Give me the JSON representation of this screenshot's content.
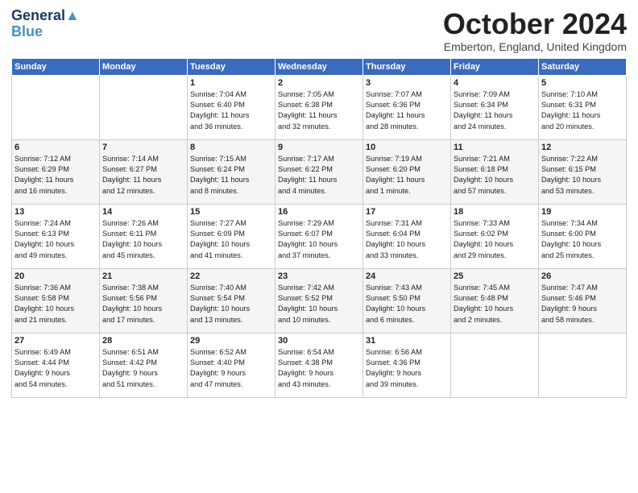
{
  "header": {
    "logo_line1": "General",
    "logo_line2": "Blue",
    "month": "October 2024",
    "location": "Emberton, England, United Kingdom"
  },
  "days_of_week": [
    "Sunday",
    "Monday",
    "Tuesday",
    "Wednesday",
    "Thursday",
    "Friday",
    "Saturday"
  ],
  "weeks": [
    [
      {
        "day": "",
        "content": ""
      },
      {
        "day": "",
        "content": ""
      },
      {
        "day": "1",
        "content": "Sunrise: 7:04 AM\nSunset: 6:40 PM\nDaylight: 11 hours\nand 36 minutes."
      },
      {
        "day": "2",
        "content": "Sunrise: 7:05 AM\nSunset: 6:38 PM\nDaylight: 11 hours\nand 32 minutes."
      },
      {
        "day": "3",
        "content": "Sunrise: 7:07 AM\nSunset: 6:36 PM\nDaylight: 11 hours\nand 28 minutes."
      },
      {
        "day": "4",
        "content": "Sunrise: 7:09 AM\nSunset: 6:34 PM\nDaylight: 11 hours\nand 24 minutes."
      },
      {
        "day": "5",
        "content": "Sunrise: 7:10 AM\nSunset: 6:31 PM\nDaylight: 11 hours\nand 20 minutes."
      }
    ],
    [
      {
        "day": "6",
        "content": "Sunrise: 7:12 AM\nSunset: 6:29 PM\nDaylight: 11 hours\nand 16 minutes."
      },
      {
        "day": "7",
        "content": "Sunrise: 7:14 AM\nSunset: 6:27 PM\nDaylight: 11 hours\nand 12 minutes."
      },
      {
        "day": "8",
        "content": "Sunrise: 7:15 AM\nSunset: 6:24 PM\nDaylight: 11 hours\nand 8 minutes."
      },
      {
        "day": "9",
        "content": "Sunrise: 7:17 AM\nSunset: 6:22 PM\nDaylight: 11 hours\nand 4 minutes."
      },
      {
        "day": "10",
        "content": "Sunrise: 7:19 AM\nSunset: 6:20 PM\nDaylight: 11 hours\nand 1 minute."
      },
      {
        "day": "11",
        "content": "Sunrise: 7:21 AM\nSunset: 6:18 PM\nDaylight: 10 hours\nand 57 minutes."
      },
      {
        "day": "12",
        "content": "Sunrise: 7:22 AM\nSunset: 6:15 PM\nDaylight: 10 hours\nand 53 minutes."
      }
    ],
    [
      {
        "day": "13",
        "content": "Sunrise: 7:24 AM\nSunset: 6:13 PM\nDaylight: 10 hours\nand 49 minutes."
      },
      {
        "day": "14",
        "content": "Sunrise: 7:26 AM\nSunset: 6:11 PM\nDaylight: 10 hours\nand 45 minutes."
      },
      {
        "day": "15",
        "content": "Sunrise: 7:27 AM\nSunset: 6:09 PM\nDaylight: 10 hours\nand 41 minutes."
      },
      {
        "day": "16",
        "content": "Sunrise: 7:29 AM\nSunset: 6:07 PM\nDaylight: 10 hours\nand 37 minutes."
      },
      {
        "day": "17",
        "content": "Sunrise: 7:31 AM\nSunset: 6:04 PM\nDaylight: 10 hours\nand 33 minutes."
      },
      {
        "day": "18",
        "content": "Sunrise: 7:33 AM\nSunset: 6:02 PM\nDaylight: 10 hours\nand 29 minutes."
      },
      {
        "day": "19",
        "content": "Sunrise: 7:34 AM\nSunset: 6:00 PM\nDaylight: 10 hours\nand 25 minutes."
      }
    ],
    [
      {
        "day": "20",
        "content": "Sunrise: 7:36 AM\nSunset: 5:58 PM\nDaylight: 10 hours\nand 21 minutes."
      },
      {
        "day": "21",
        "content": "Sunrise: 7:38 AM\nSunset: 5:56 PM\nDaylight: 10 hours\nand 17 minutes."
      },
      {
        "day": "22",
        "content": "Sunrise: 7:40 AM\nSunset: 5:54 PM\nDaylight: 10 hours\nand 13 minutes."
      },
      {
        "day": "23",
        "content": "Sunrise: 7:42 AM\nSunset: 5:52 PM\nDaylight: 10 hours\nand 10 minutes."
      },
      {
        "day": "24",
        "content": "Sunrise: 7:43 AM\nSunset: 5:50 PM\nDaylight: 10 hours\nand 6 minutes."
      },
      {
        "day": "25",
        "content": "Sunrise: 7:45 AM\nSunset: 5:48 PM\nDaylight: 10 hours\nand 2 minutes."
      },
      {
        "day": "26",
        "content": "Sunrise: 7:47 AM\nSunset: 5:46 PM\nDaylight: 9 hours\nand 58 minutes."
      }
    ],
    [
      {
        "day": "27",
        "content": "Sunrise: 6:49 AM\nSunset: 4:44 PM\nDaylight: 9 hours\nand 54 minutes."
      },
      {
        "day": "28",
        "content": "Sunrise: 6:51 AM\nSunset: 4:42 PM\nDaylight: 9 hours\nand 51 minutes."
      },
      {
        "day": "29",
        "content": "Sunrise: 6:52 AM\nSunset: 4:40 PM\nDaylight: 9 hours\nand 47 minutes."
      },
      {
        "day": "30",
        "content": "Sunrise: 6:54 AM\nSunset: 4:38 PM\nDaylight: 9 hours\nand 43 minutes."
      },
      {
        "day": "31",
        "content": "Sunrise: 6:56 AM\nSunset: 4:36 PM\nDaylight: 9 hours\nand 39 minutes."
      },
      {
        "day": "",
        "content": ""
      },
      {
        "day": "",
        "content": ""
      }
    ]
  ]
}
